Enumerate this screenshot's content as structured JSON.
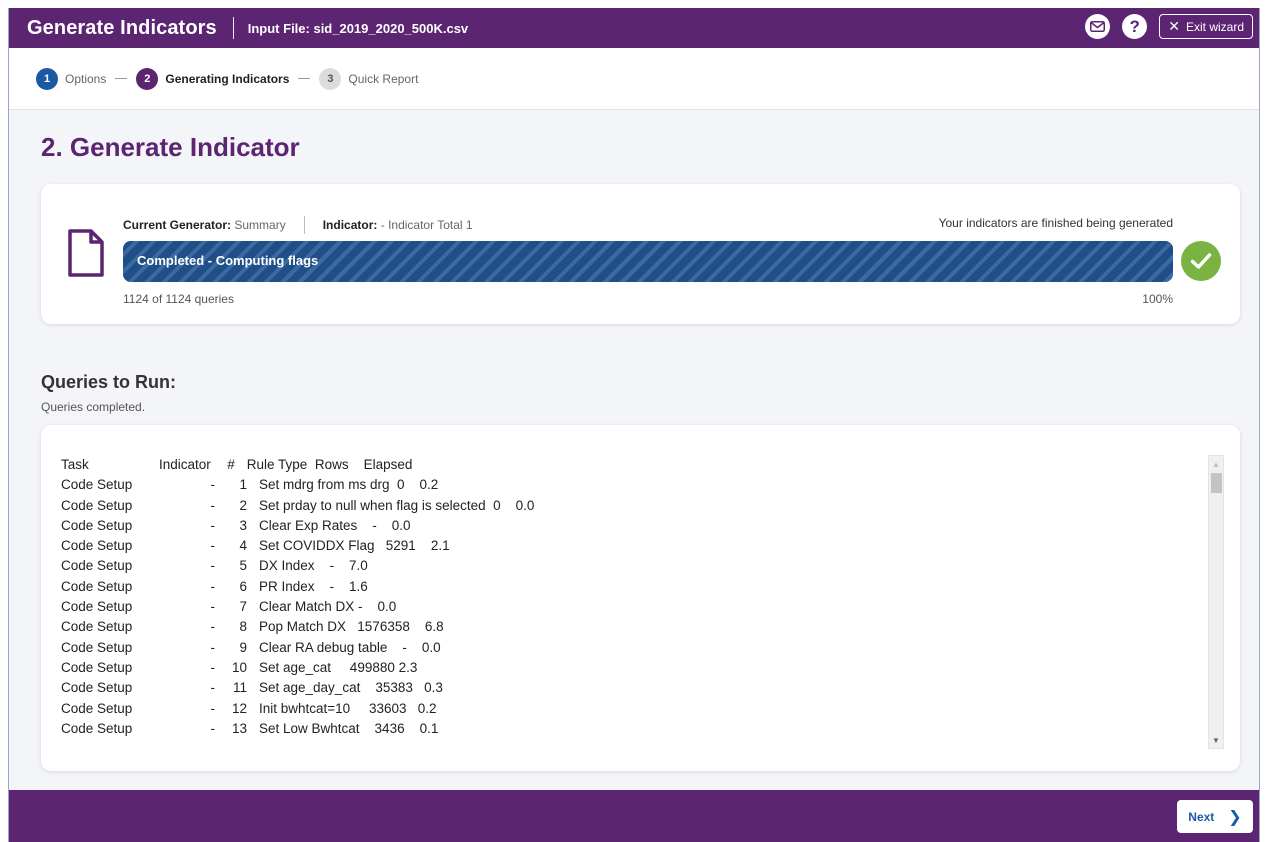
{
  "header": {
    "title": "Generate Indicators",
    "input_file": "Input File: sid_2019_2020_500K.csv",
    "exit_label": "Exit wizard",
    "help_symbol": "?"
  },
  "steps": [
    {
      "num": "1",
      "label": "Options"
    },
    {
      "num": "2",
      "label": "Generating Indicators"
    },
    {
      "num": "3",
      "label": "Quick Report"
    }
  ],
  "page_title": "2. Generate Indicator",
  "progress": {
    "generator_label": "Current Generator:",
    "generator_value": "Summary",
    "indicator_label": "Indicator:",
    "indicator_value": "- Indicator Total 1",
    "finished_text": "Your indicators are finished being generated",
    "bar_text": "Completed - Computing flags",
    "count_text": "1124 of 1124 queries",
    "percent_text": "100%",
    "fraction": 1.0
  },
  "queries": {
    "title": "Queries to Run:",
    "status": "Queries completed.",
    "header": {
      "task": "Task",
      "indicator": "Indicator",
      "num": "#",
      "rest": "Rule Type  Rows    Elapsed"
    },
    "rows": [
      {
        "task": "Code Setup",
        "indicator": "-",
        "num": "1",
        "rest": "Set mdrg from ms drg  0    0.2"
      },
      {
        "task": "Code Setup",
        "indicator": "-",
        "num": "2",
        "rest": "Set prday to null when flag is selected  0    0.0"
      },
      {
        "task": "Code Setup",
        "indicator": "-",
        "num": "3",
        "rest": "Clear Exp Rates    -    0.0"
      },
      {
        "task": "Code Setup",
        "indicator": "-",
        "num": "4",
        "rest": "Set COVIDDX Flag   5291    2.1"
      },
      {
        "task": "Code Setup",
        "indicator": "-",
        "num": "5",
        "rest": "DX Index    -    7.0"
      },
      {
        "task": "Code Setup",
        "indicator": "-",
        "num": "6",
        "rest": "PR Index    -    1.6"
      },
      {
        "task": "Code Setup",
        "indicator": "-",
        "num": "7",
        "rest": "Clear Match DX -    0.0"
      },
      {
        "task": "Code Setup",
        "indicator": "-",
        "num": "8",
        "rest": "Pop Match DX   1576358    6.8"
      },
      {
        "task": "Code Setup",
        "indicator": "-",
        "num": "9",
        "rest": "Clear RA debug table    -    0.0"
      },
      {
        "task": "Code Setup",
        "indicator": "-",
        "num": "10",
        "rest": "Set age_cat     499880 2.3"
      },
      {
        "task": "Code Setup",
        "indicator": "-",
        "num": "11",
        "rest": "Set age_day_cat    35383   0.3"
      },
      {
        "task": "Code Setup",
        "indicator": "-",
        "num": "12",
        "rest": "Init bwhtcat=10     33603   0.2"
      },
      {
        "task": "Code Setup",
        "indicator": "-",
        "num": "13",
        "rest": "Set Low Bwhtcat    3436    0.1"
      }
    ]
  },
  "footer": {
    "next_label": "Next"
  },
  "colors": {
    "brand": "#5c2572",
    "accent": "#1b5aa3",
    "success": "#7bb342"
  }
}
